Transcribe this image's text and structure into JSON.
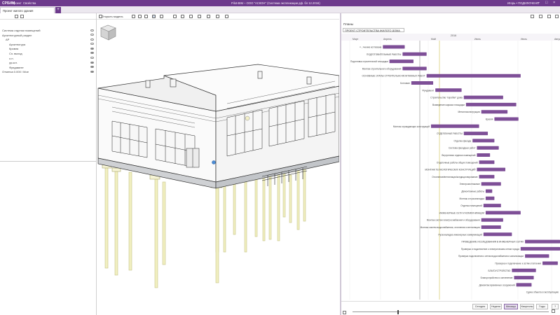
{
  "titlebar": {
    "brand": "СРБИМ",
    "menu": [
      "Проект",
      "Свойства"
    ],
    "window_title": "Pilot-BIM – ООО \"АСКОН\" (Система экспликации дф. бл 12.2016)",
    "user": "Игорь • ПОДКЛЮЧЕНО",
    "controls": [
      "–",
      "□",
      "×"
    ]
  },
  "tab": {
    "label": "Проект жилого здания",
    "add": "+"
  },
  "model_tree": [
    {
      "label": "Система отделки помещений",
      "indent": 0,
      "visible": false
    },
    {
      "label": "Архитектурный раздел",
      "indent": 0,
      "visible": false
    },
    {
      "label": "АР",
      "indent": 1,
      "visible": false
    },
    {
      "label": "Архитектура",
      "indent": 2,
      "visible": false
    },
    {
      "label": "Кровля",
      "indent": 2,
      "visible": true
    },
    {
      "label": "Сэ. выход",
      "indent": 2,
      "visible": true
    },
    {
      "label": "о.п.",
      "indent": 2,
      "visible": false
    },
    {
      "label": "ур.кот.",
      "indent": 2,
      "visible": true
    },
    {
      "label": "Фундамент",
      "indent": 2,
      "visible": true
    },
    {
      "label": "Отметка 0.000 / Мое",
      "indent": 0,
      "visible": true
    }
  ],
  "viewport": {
    "mode_label": "Открыть модель"
  },
  "gantt": {
    "panel_title": "Планы",
    "project_select": "ПРОЕКТ СТРОИТЕЛЬСТВА ЖИЛОГО ДОМА",
    "year": "2016",
    "months": [
      "Март",
      "Апрель",
      "Май",
      "Июнь",
      "Июль",
      "Август"
    ],
    "zoom_buttons": [
      "Сегодня",
      "Недели",
      "Месяцы",
      "Кварталы",
      "Годы",
      "?"
    ],
    "active_zoom": "Месяцы",
    "tasks": [
      {
        "label": "«...»нение котлована",
        "start": 0.19,
        "end": 0.29
      },
      {
        "label": "ПОДГОТОВИТЕЛЬНЫЕ РАБОТЫ",
        "start": 0.28,
        "end": 0.39
      },
      {
        "label": "Подготовка строительной площадки",
        "start": 0.22,
        "end": 0.33
      },
      {
        "label": "Монтаж строительного оборудования",
        "start": 0.28,
        "end": 0.39
      },
      {
        "label": "ОСНОВНЫЕ ЭТАПЫ СТРОИТЕЛЬНО-МОНТАЖНЫХ РАБОТ",
        "start": 0.39,
        "end": 0.82
      },
      {
        "label": "Котлован",
        "start": 0.32,
        "end": 0.42
      },
      {
        "label": "Фундамент",
        "start": 0.43,
        "end": 0.55
      },
      {
        "label": "Строительство \"коробки\" дома",
        "start": 0.56,
        "end": 0.74
      },
      {
        "label": "Возведение каркаса площадки",
        "start": 0.57,
        "end": 0.8
      },
      {
        "label": "Металлоконструкции",
        "start": 0.64,
        "end": 0.76
      },
      {
        "label": "Кровля",
        "start": 0.7,
        "end": 0.81
      },
      {
        "label": "Монтаж ограждающих конструкций",
        "start": 0.41,
        "end": 0.63
      },
      {
        "label": "ОТДЕЛОЧНЫЕ РАБОТЫ",
        "start": 0.56,
        "end": 0.67
      },
      {
        "label": "Отделка фасада",
        "start": 0.6,
        "end": 0.7
      },
      {
        "label": "Система фасадных работ",
        "start": 0.62,
        "end": 0.72
      },
      {
        "label": "Внутренняя отделка помещений",
        "start": 0.62,
        "end": 0.68
      },
      {
        "label": "Отделочные работы общих помещений",
        "start": 0.63,
        "end": 0.7
      },
      {
        "label": "МОНТАЖ ТЕХНОЛОГИЧЕСКИХ КОНСТРУКЦИЙ",
        "start": 0.62,
        "end": 0.75
      },
      {
        "label": "Отопление/вентиляция/кондиционирование",
        "start": 0.63,
        "end": 0.7
      },
      {
        "label": "Электромонтажные",
        "start": 0.64,
        "end": 0.73
      },
      {
        "label": "Демонтажные работы",
        "start": 0.66,
        "end": 0.69
      },
      {
        "label": "Монтаж и пусконаладка",
        "start": 0.66,
        "end": 0.7
      },
      {
        "label": "Отделка помещений",
        "start": 0.65,
        "end": 0.73
      },
      {
        "label": "ИНЖЕНЕРНЫЕ СЕТИ И КОММУНИКАЦИИ",
        "start": 0.66,
        "end": 0.82
      },
      {
        "label": "Монтаж систем электроснабжения и оборудования",
        "start": 0.64,
        "end": 0.74
      },
      {
        "label": "Монтаж систем водоснабжения, отопления и вентиляции",
        "start": 0.64,
        "end": 0.73
      },
      {
        "label": "Пусконаладка инженерных коммуникаций",
        "start": 0.65,
        "end": 0.78
      },
      {
        "label": "ПРОВЕДЕНИЕ ИССЛЕДОВАНИЯ В ИНЖЕНЕРНЫХ СЕТЯХ",
        "start": 0.84,
        "end": 1.0
      },
      {
        "label": "Проверка и подключение к электрическим сетям города",
        "start": 0.82,
        "end": 1.0
      },
      {
        "label": "Проверка подключения к сетям водоснабжения и канализации",
        "start": 0.84,
        "end": 0.95
      },
      {
        "label": "Проверка и подключение к сетям отопления",
        "start": 0.92,
        "end": 0.99
      },
      {
        "label": "БЛАГОУСТРОЙСТВО",
        "start": 0.78,
        "end": 0.89
      },
      {
        "label": "Благоустройство и озеленение",
        "start": 0.79,
        "end": 0.88
      },
      {
        "label": "Демонтаж временных сооружений",
        "start": 0.8,
        "end": 0.87
      },
      {
        "label": "Сдача объекта в эксплуатацию",
        "start": null,
        "end": null
      }
    ]
  },
  "colors": {
    "titlebar": "#6d3a8c",
    "bar": "#7e4f97",
    "today_line": "#d9d07a",
    "column_fill": "#f3f1c6"
  }
}
